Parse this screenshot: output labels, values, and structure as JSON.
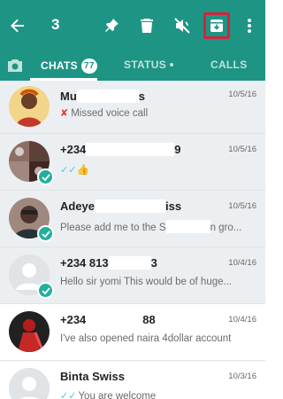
{
  "topbar": {
    "selected_count": "3",
    "icons": [
      "back-arrow-icon",
      "pin-icon",
      "delete-icon",
      "mute-icon",
      "archive-icon",
      "more-vert-icon"
    ],
    "highlight_color": "#d0263a",
    "background": "#1e9484"
  },
  "tabs": {
    "camera_icon": "camera-icon",
    "chats": "CHATS",
    "chats_badge": "77",
    "status": "STATUS",
    "calls": "CALLS"
  },
  "chats": [
    {
      "name": "Mu",
      "name_tail": "s",
      "date": "10/5/16",
      "message": "Missed voice call",
      "status_icon": "missed-call-icon",
      "selected": false
    },
    {
      "name": "+234",
      "name_tail": "9",
      "date": "10/5/16",
      "message": "👍",
      "status_icon": "double-tick-icon",
      "selected": true
    },
    {
      "name": "Adeye",
      "name_tail": "iss",
      "date": "10/5/16",
      "message": "Please add me to the S",
      "message_tail": "n gro...",
      "selected": true
    },
    {
      "name": "+234 813",
      "name_tail": "3",
      "date": "10/4/16",
      "message": "Hello sir yomi This would be of huge...",
      "selected": true
    },
    {
      "name": "+234",
      "name_tail": "88",
      "date": "10/4/16",
      "message": "I've also opened naira 4dollar account",
      "selected": false
    },
    {
      "name": "Binta Swiss",
      "date": "10/3/16",
      "message": "You are welcome",
      "status_icon": "double-tick-icon",
      "selected": false
    }
  ]
}
